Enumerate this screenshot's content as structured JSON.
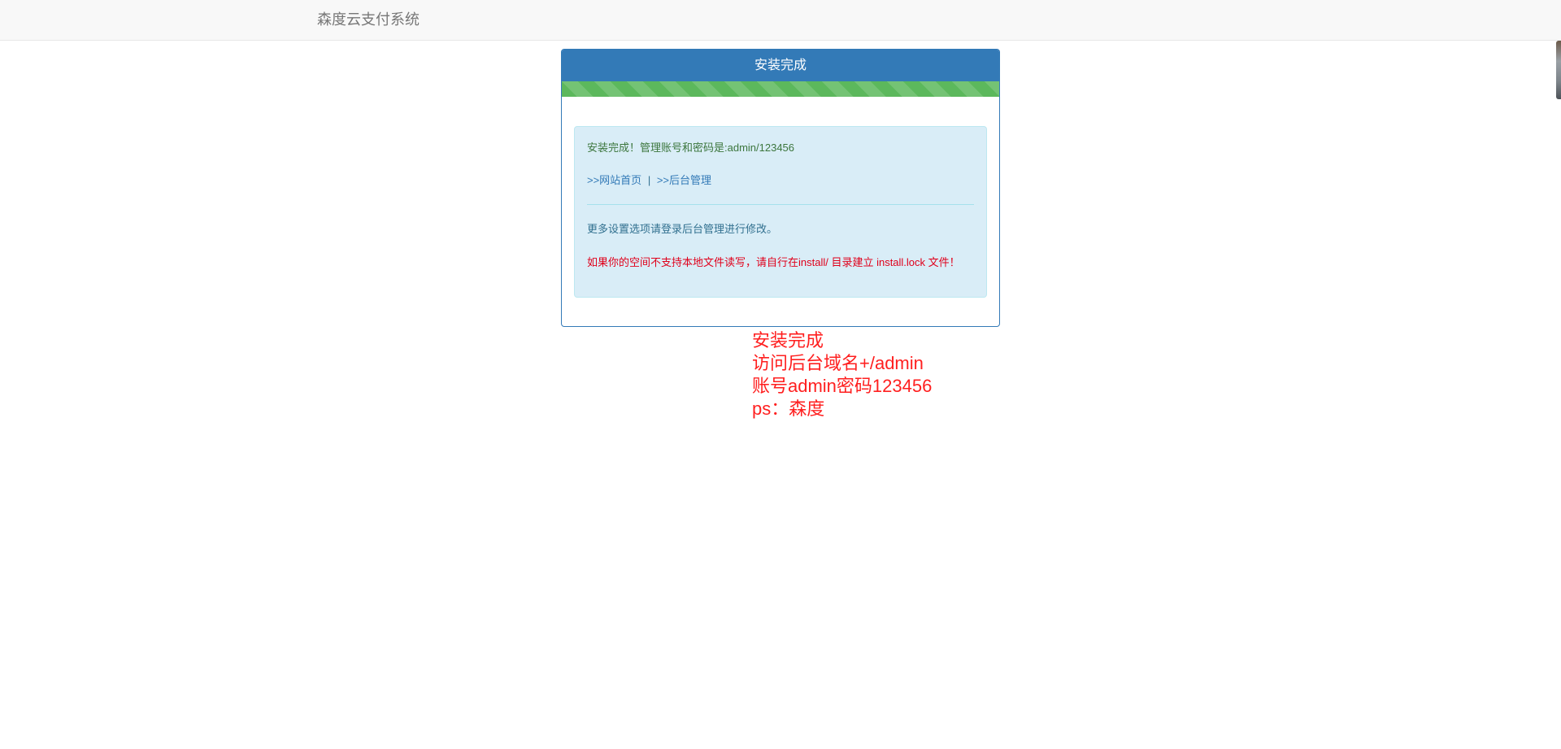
{
  "navbar": {
    "brand": "森度云支付系统"
  },
  "panel": {
    "title": "安装完成",
    "progress_percent": 100,
    "progress_color": "#5cb85c",
    "alert": {
      "success_text": "安装完成！管理账号和密码是:admin/123456",
      "links": {
        "home": ">>网站首页",
        "separator": "|",
        "admin": ">>后台管理"
      },
      "note": "更多设置选项请登录后台管理进行修改。",
      "warning": "如果你的空间不支持本地文件读写，请自行在install/ 目录建立 install.lock 文件！"
    }
  },
  "annotation": {
    "lines": [
      "安装完成",
      "访问后台域名+/admin",
      "账号admin密码123456",
      "ps：森度"
    ]
  },
  "colors": {
    "primary": "#337ab7",
    "success": "#3c763d",
    "info_bg": "#d9edf7",
    "danger": "#e0001b",
    "annotation": "#ff1f1f"
  }
}
